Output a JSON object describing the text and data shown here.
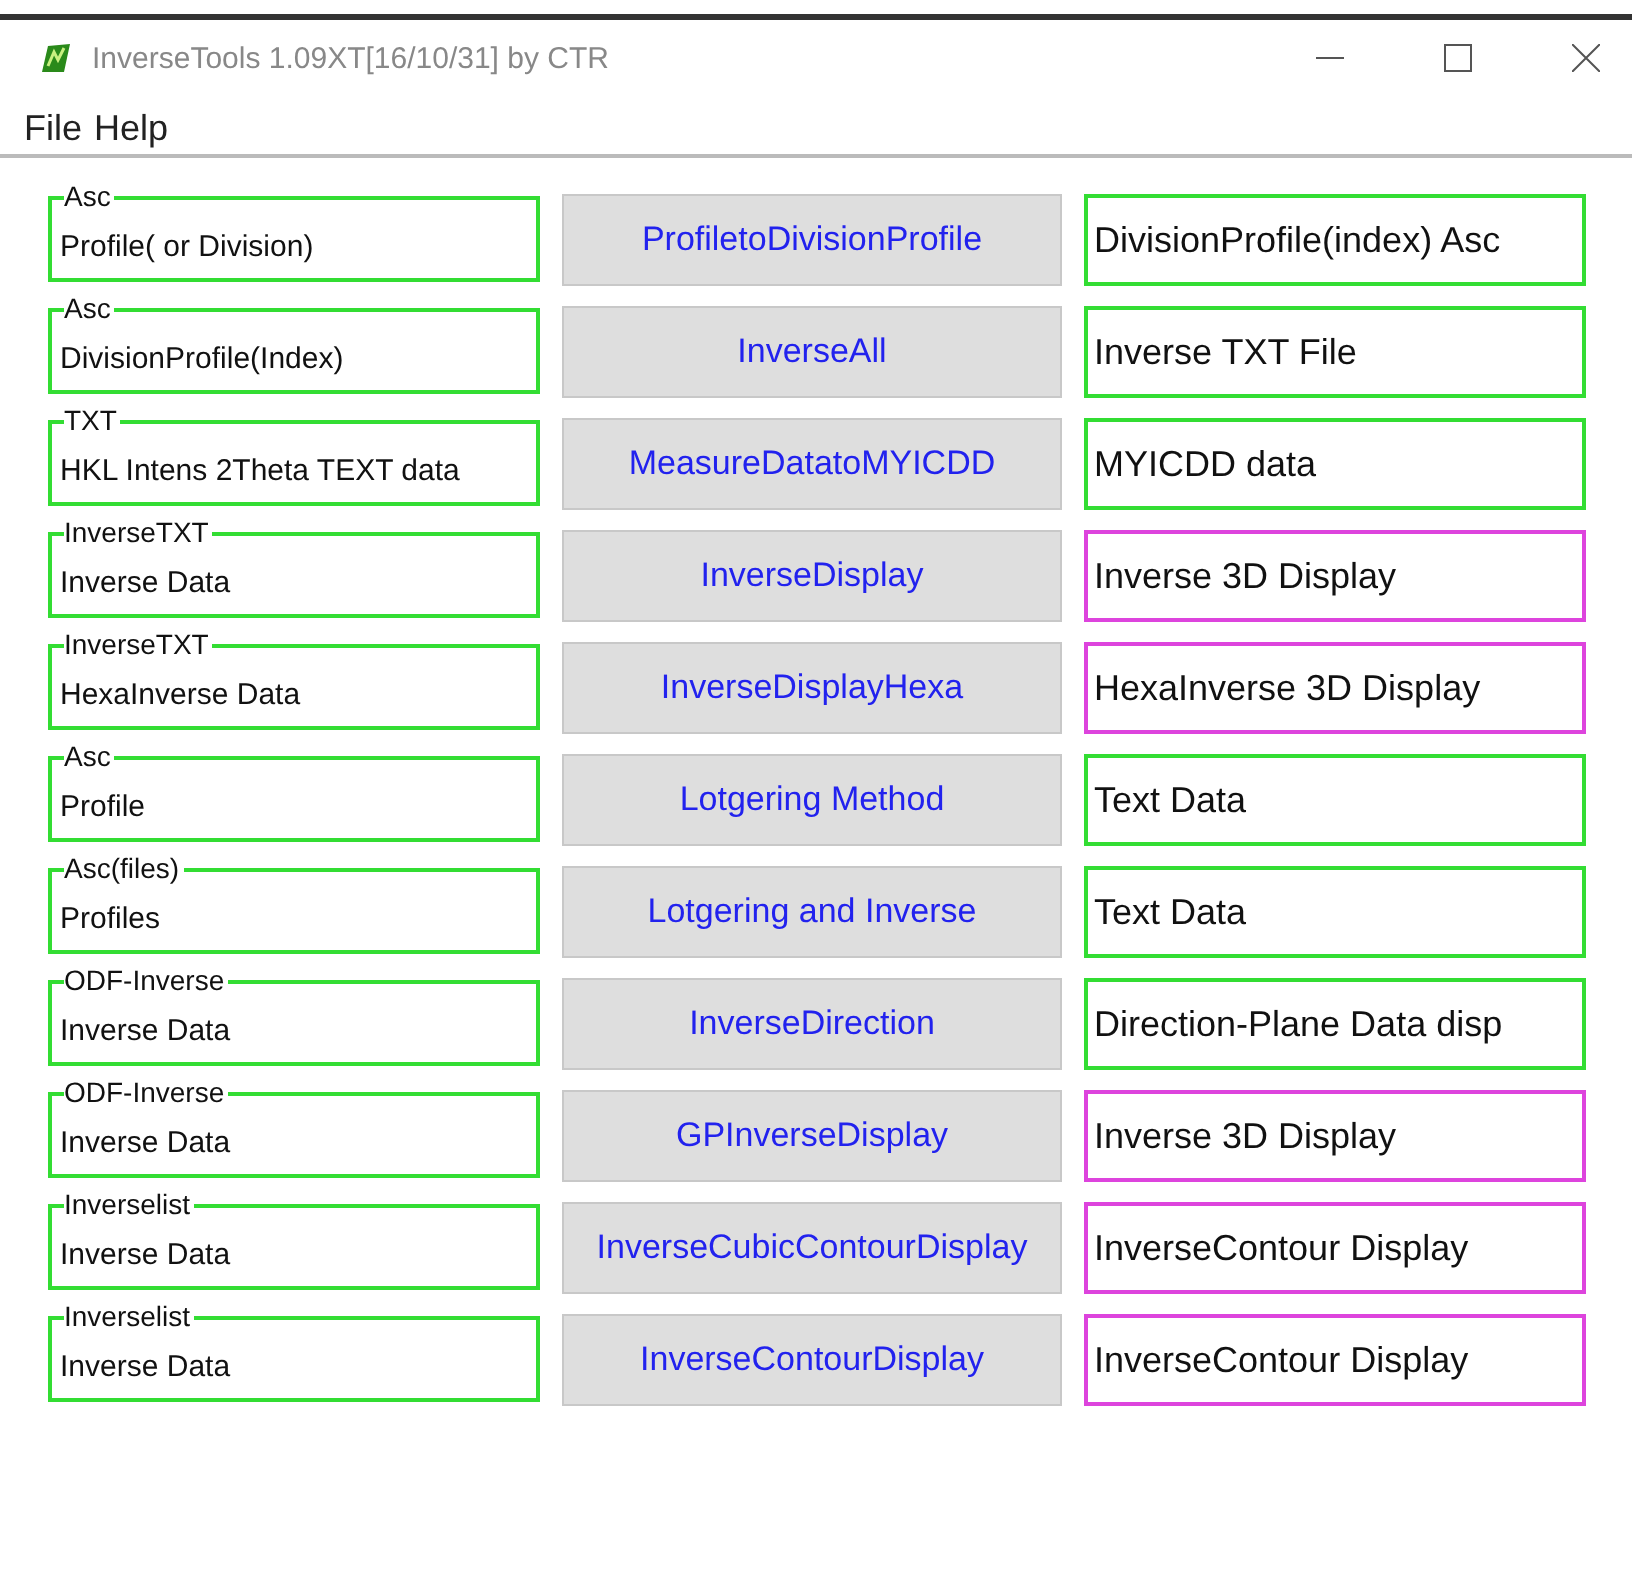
{
  "window": {
    "title": "InverseTools 1.09XT[16/10/31] by CTR"
  },
  "menu": [
    "File",
    "Help"
  ],
  "rows": [
    {
      "group": "Asc",
      "input": "Profile( or Division)",
      "button": "ProfiletoDivisionProfile",
      "output": "DivisionProfile(index) Asc",
      "color": "#33dd33"
    },
    {
      "group": "Asc",
      "input": "DivisionProfile(Index)",
      "button": "InverseAll",
      "output": "Inverse TXT File",
      "color": "#33dd33"
    },
    {
      "group": "TXT",
      "input": "HKL Intens 2Theta TEXT data",
      "button": "MeasureDatatoMYICDD",
      "output": "MYICDD data",
      "color": "#33dd33"
    },
    {
      "group": "InverseTXT",
      "input": "Inverse Data",
      "button": "InverseDisplay",
      "output": "Inverse 3D Display",
      "color": "#dd44dd"
    },
    {
      "group": "InverseTXT",
      "input": "HexaInverse Data",
      "button": "InverseDisplayHexa",
      "output": "HexaInverse 3D Display",
      "color": "#dd44dd"
    },
    {
      "group": "Asc",
      "input": "Profile",
      "button": "Lotgering Method",
      "output": "Text Data",
      "color": "#33dd33"
    },
    {
      "group": "Asc(files)",
      "input": "Profiles",
      "button": "Lotgering and Inverse",
      "output": "Text Data",
      "color": "#33dd33"
    },
    {
      "group": "ODF-Inverse",
      "input": "Inverse Data",
      "button": "InverseDirection",
      "output": "Direction-Plane Data disp",
      "color": "#33dd33"
    },
    {
      "group": "ODF-Inverse",
      "input": "Inverse Data",
      "button": "GPInverseDisplay",
      "output": "Inverse 3D Display",
      "color": "#dd44dd"
    },
    {
      "group": "Inverselist",
      "input": "Inverse Data",
      "button": "InverseCubicContourDisplay",
      "output": "InverseContour Display",
      "color": "#dd44dd"
    },
    {
      "group": "Inverselist",
      "input": "Inverse Data",
      "button": "InverseContourDisplay",
      "output": "InverseContour Display",
      "color": "#dd44dd"
    }
  ]
}
